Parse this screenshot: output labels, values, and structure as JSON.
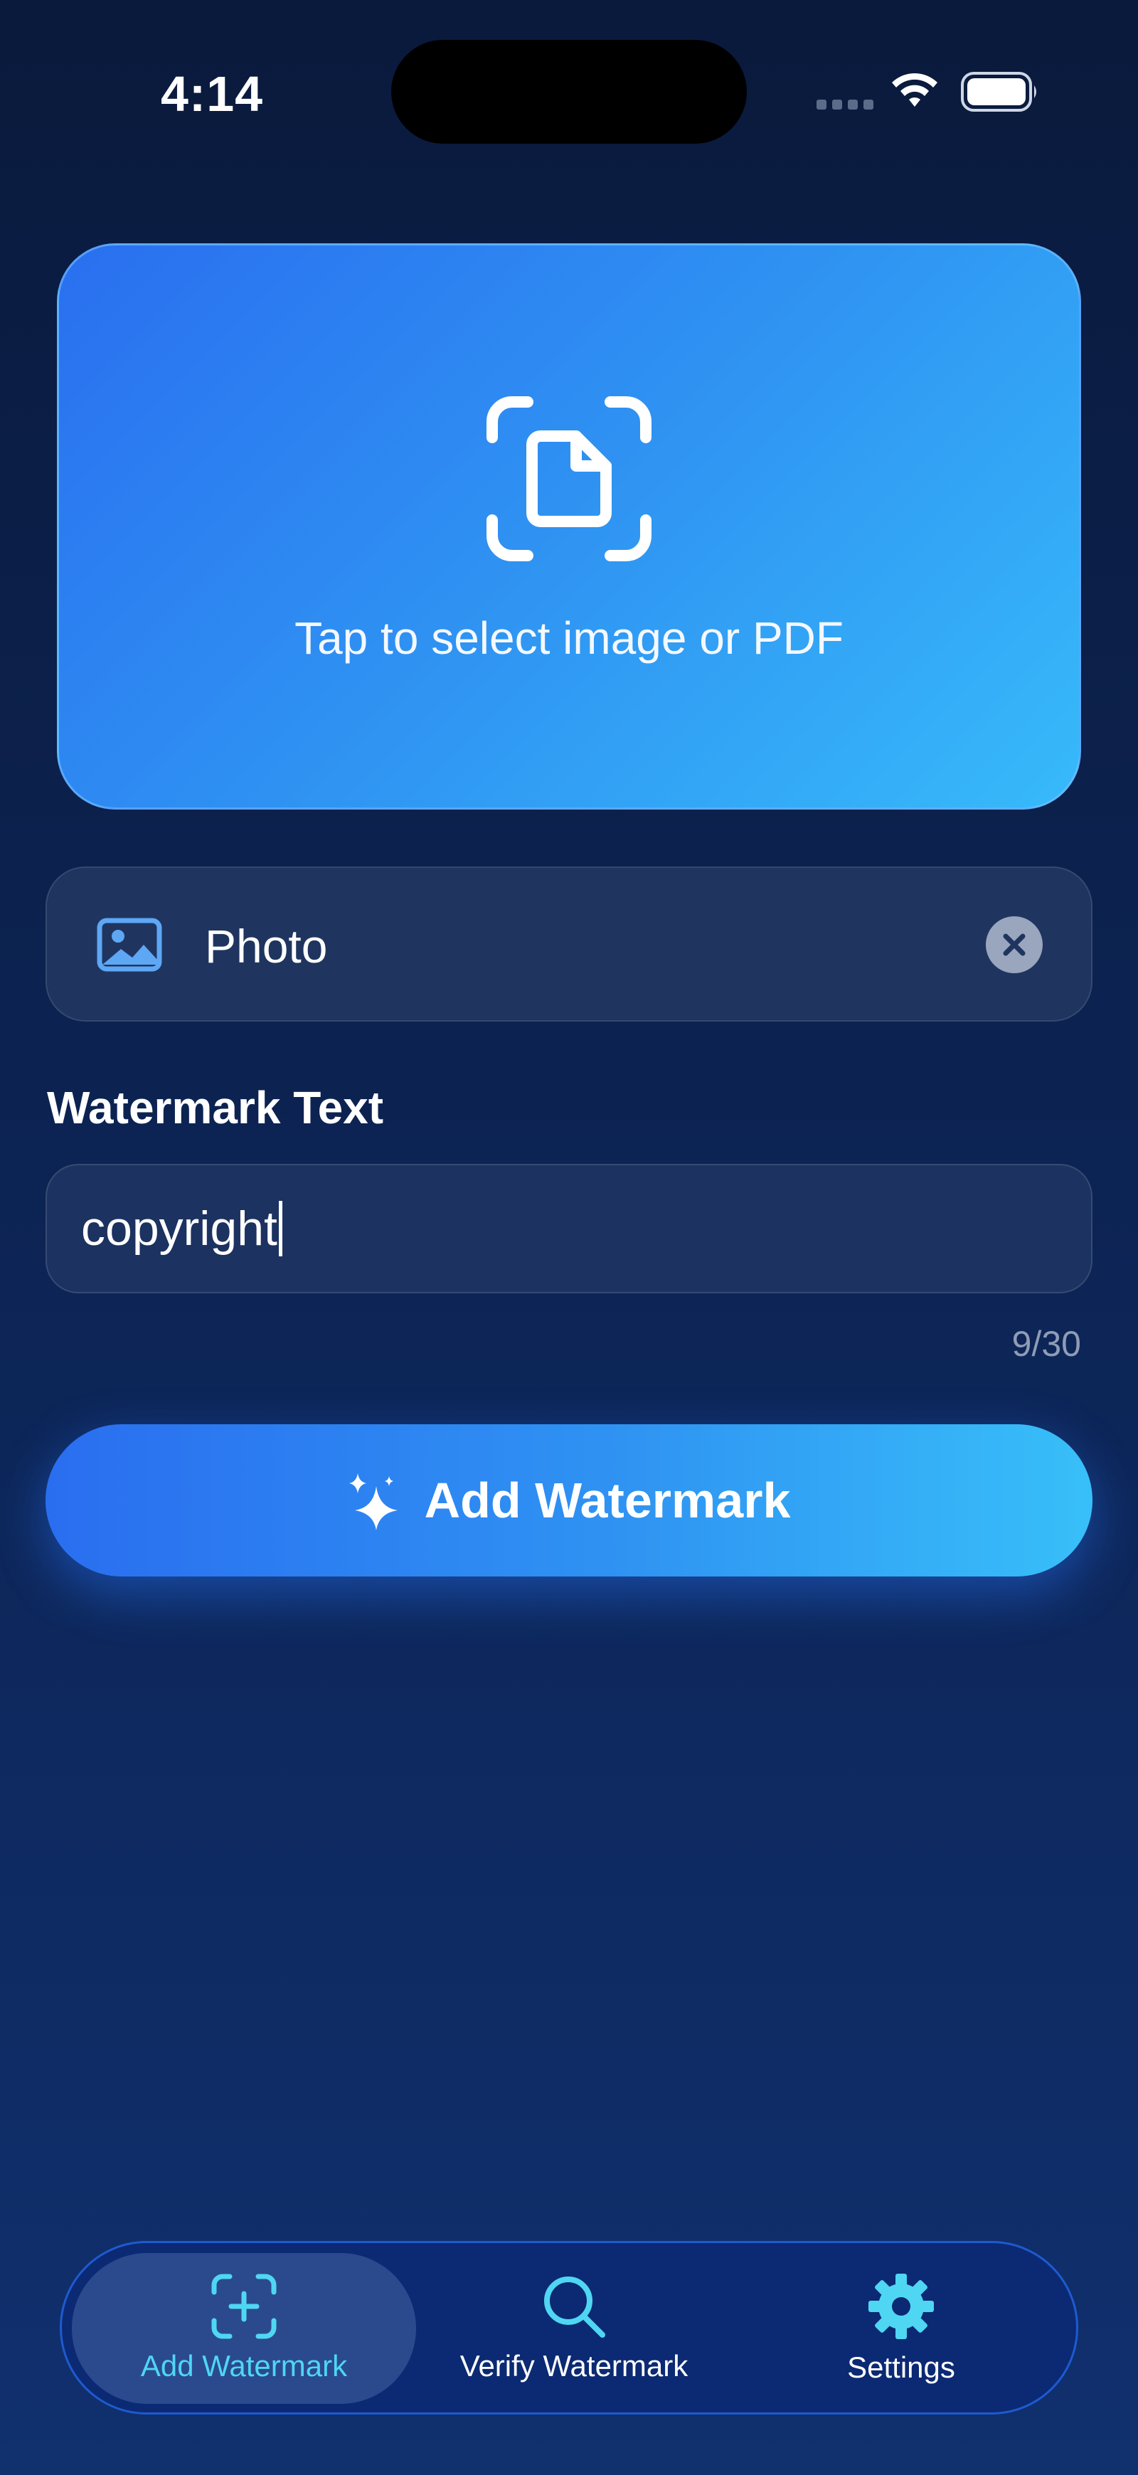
{
  "status_bar": {
    "time": "4:14"
  },
  "upload": {
    "label": "Tap to select image or PDF",
    "icon": "document-scan-icon"
  },
  "selected_file": {
    "icon": "photo-icon",
    "name": "Photo",
    "clear_icon": "close-icon"
  },
  "watermark": {
    "section_label": "Watermark Text",
    "value": "copyright",
    "counter": "9/30"
  },
  "primary_action": {
    "icon": "sparkles-icon",
    "label": "Add Watermark"
  },
  "tab_bar": {
    "tabs": [
      {
        "label": "Add Watermark",
        "icon": "plus-viewfinder-icon",
        "active": true
      },
      {
        "label": "Verify Watermark",
        "icon": "magnifying-glass-icon",
        "active": false
      },
      {
        "label": "Settings",
        "icon": "gear-icon",
        "active": false
      }
    ]
  },
  "colors": {
    "accent": "#2f93f2",
    "active_tab_text": "#4fd6f2",
    "background": "#0c2250"
  }
}
